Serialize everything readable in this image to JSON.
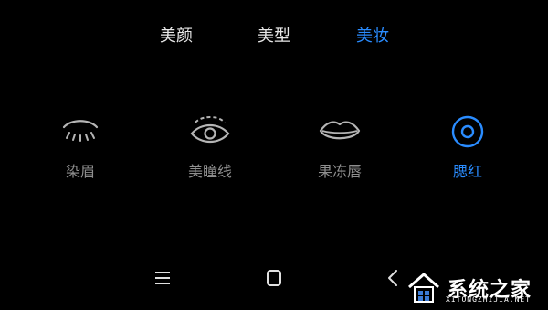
{
  "tabs": [
    {
      "label": "美颜",
      "active": false
    },
    {
      "label": "美型",
      "active": false
    },
    {
      "label": "美妆",
      "active": true
    }
  ],
  "options": [
    {
      "label": "染眉",
      "icon": "eyebrow-icon",
      "active": false
    },
    {
      "label": "美瞳线",
      "icon": "eye-icon",
      "active": false
    },
    {
      "label": "果冻唇",
      "icon": "lips-icon",
      "active": false
    },
    {
      "label": "腮红",
      "icon": "blush-icon",
      "active": true
    }
  ],
  "nav": {
    "menu_icon": "menu-icon",
    "home_icon": "home-icon",
    "back_icon": "back-icon"
  },
  "watermark": {
    "brand": "系统之家",
    "url": "XITONGZHIJIA.NET"
  },
  "colors": {
    "accent": "#2a8cff",
    "text": "#e8e8e8",
    "muted": "#8f8f8f",
    "background": "#000000"
  }
}
